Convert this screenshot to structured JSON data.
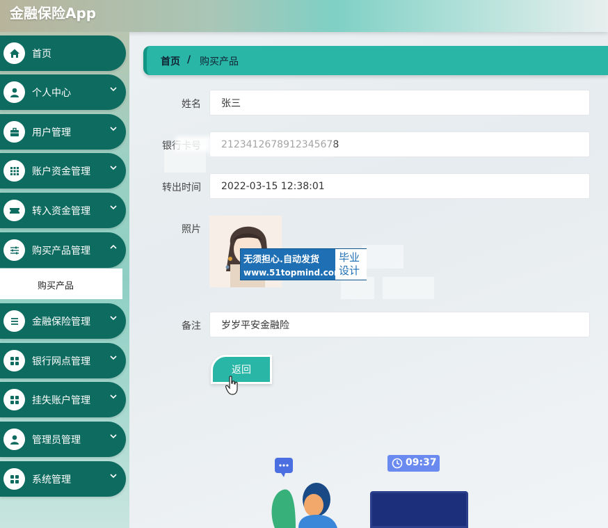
{
  "app": {
    "title": "金融保险App"
  },
  "sidebar": {
    "items": [
      {
        "label": "首页",
        "icon": "home-icon",
        "has_arrow": false
      },
      {
        "label": "个人中心",
        "icon": "user-icon",
        "has_arrow": true
      },
      {
        "label": "用户管理",
        "icon": "briefcase-icon",
        "has_arrow": true
      },
      {
        "label": "账户资金管理",
        "icon": "grid-icon",
        "has_arrow": true
      },
      {
        "label": "转入资金管理",
        "icon": "ticket-icon",
        "has_arrow": true
      },
      {
        "label": "购买产品管理",
        "icon": "sliders-icon",
        "has_arrow": true
      },
      {
        "label": "金融保险管理",
        "icon": "list-icon",
        "has_arrow": true
      },
      {
        "label": "银行网点管理",
        "icon": "apps-icon",
        "has_arrow": true
      },
      {
        "label": "挂失账户管理",
        "icon": "apps-icon",
        "has_arrow": true
      },
      {
        "label": "管理员管理",
        "icon": "user-icon",
        "has_arrow": true
      },
      {
        "label": "系统管理",
        "icon": "apps-icon",
        "has_arrow": true
      }
    ],
    "active_sub_item": "购买产品"
  },
  "breadcrumb": {
    "home": "首页",
    "separator": "/",
    "current": "购买产品"
  },
  "form": {
    "name_label": "姓名",
    "name_value": "张三",
    "card_label": "银行卡号",
    "card_value": "2123412678912345678",
    "time_label": "转出时间",
    "time_value": "2022-03-15 12:38:01",
    "photo_label": "照片",
    "remark_label": "备注",
    "remark_value": "岁岁平安金融险",
    "back_button": "返回"
  },
  "watermark": {
    "line1": "无须担心.自动发货",
    "line2": "www.51topmind.com",
    "badge": "毕业设计"
  },
  "illustration": {
    "clock": "09:37"
  },
  "colors": {
    "sidebar_item": "#0e6b60",
    "accent": "#2ab6a6"
  }
}
